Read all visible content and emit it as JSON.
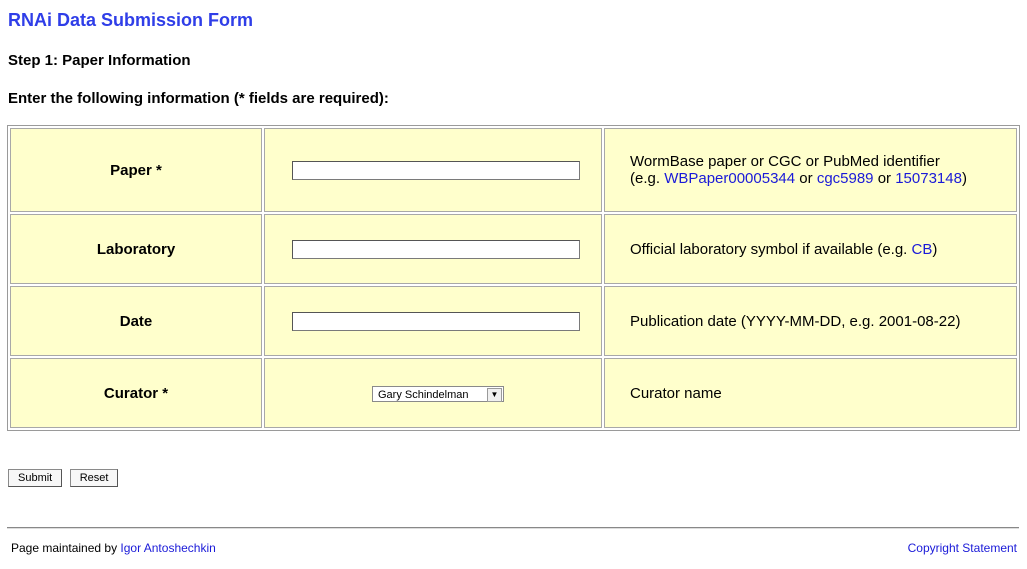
{
  "page": {
    "title": "RNAi Data Submission Form",
    "step": "Step 1: Paper Information",
    "instructions": "Enter the following information (* fields are required):"
  },
  "colors": {
    "title": "#2f3ee8",
    "cell_background": "#ffffcc",
    "link": "#1a1ad8"
  },
  "form": {
    "paper": {
      "label": "Paper *",
      "value": "",
      "desc_line1": "WormBase paper or CGC or PubMed identifier",
      "desc_prefix": "(e.g. ",
      "example1": "WBPaper00005344",
      "or1": " or ",
      "example2": "cgc5989",
      "or2": " or ",
      "example3": "15073148",
      "desc_suffix": ")"
    },
    "laboratory": {
      "label": "Laboratory",
      "value": "",
      "desc": "Official laboratory symbol if available (e.g. ",
      "example": "CB",
      "desc_suffix": ")"
    },
    "date": {
      "label": "Date",
      "value": "",
      "desc": "Publication date (YYYY-MM-DD, e.g. 2001-08-22)"
    },
    "curator": {
      "label": "Curator *",
      "selected": "Gary Schindelman",
      "arrow_icon": "chevron-down-icon",
      "desc": "Curator name"
    }
  },
  "buttons": {
    "submit": "Submit",
    "reset": "Reset"
  },
  "footer": {
    "maintained_prefix": "Page maintained by ",
    "maintainer": "Igor Antoshechkin",
    "copyright": "Copyright Statement"
  }
}
